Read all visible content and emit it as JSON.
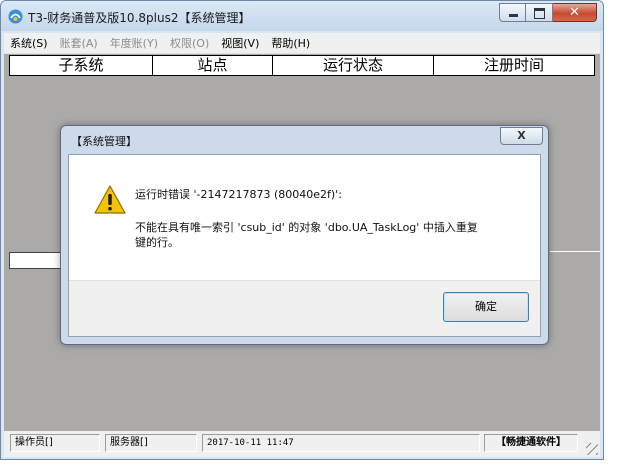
{
  "window": {
    "title": "T3-财务通普及版10.8plus2【系统管理】",
    "buttons": {
      "minimize": "minimize-icon",
      "maximize": "maximize-icon",
      "close": "close-icon"
    }
  },
  "menu": [
    {
      "label": "系统(S)",
      "enabled": true
    },
    {
      "label": "账套(A)",
      "enabled": false
    },
    {
      "label": "年度账(Y)",
      "enabled": false
    },
    {
      "label": "权限(O)",
      "enabled": false
    },
    {
      "label": "视图(V)",
      "enabled": true
    },
    {
      "label": "帮助(H)",
      "enabled": true
    }
  ],
  "grid": {
    "columns": [
      "子系统",
      "站点",
      "运行状态",
      "注册时间"
    ]
  },
  "statusbar": {
    "operator": "操作员[]",
    "server": "服务器[]",
    "datetime": "2017-10-11 11:47",
    "brand": "【畅捷通软件】"
  },
  "dialog": {
    "title": "【系统管理】",
    "close_glyph": "X",
    "icon": "warning-icon",
    "line1": "运行时错误 '-2147217873 (80040e2f)':",
    "line2": "不能在具有唯一索引 'csub_id' 的对象 'dbo.UA_TaskLog' 中插入重复\n键的行。",
    "ok_label": "确定"
  },
  "colors": {
    "titlebar": "#c4d7ec",
    "client_bg": "#abaaa8",
    "close_button": "#c74a33",
    "warning": "#f5c400"
  }
}
